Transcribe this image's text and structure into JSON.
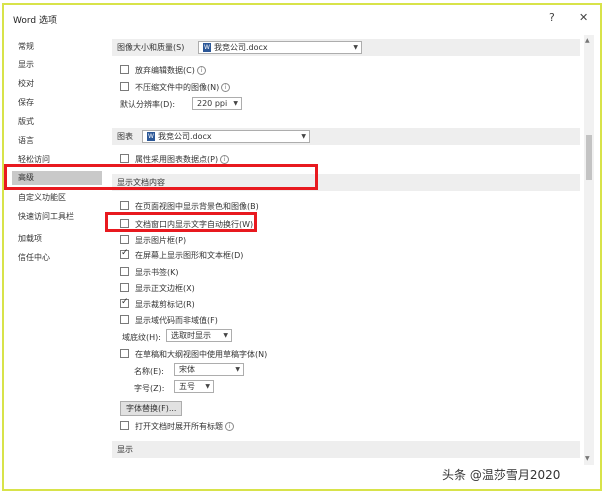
{
  "window": {
    "title": "Word 选项",
    "help": "?",
    "close": "✕"
  },
  "sidebar": {
    "items": [
      {
        "label": "常规"
      },
      {
        "label": "显示"
      },
      {
        "label": "校对"
      },
      {
        "label": "保存"
      },
      {
        "label": "版式"
      },
      {
        "label": "语言"
      },
      {
        "label": "轻松访问"
      },
      {
        "label": "高级"
      },
      {
        "label": "自定义功能区"
      },
      {
        "label": "快速访问工具栏"
      },
      {
        "label": "加载项"
      },
      {
        "label": "信任中心"
      }
    ],
    "selected": "高级"
  },
  "image_section": {
    "header": "图像大小和质量(S)",
    "file": "我竞公司.docx",
    "opt_discard": "放弃编辑数据(C)",
    "opt_nocompress": "不压缩文件中的图像(N)",
    "resolution_label": "默认分辨率(D):",
    "resolution_value": "220 ppi"
  },
  "chart_section": {
    "header": "图表",
    "file": "我竞公司.docx",
    "opt_props": "属性采用图表数据点(P)"
  },
  "doc_content": {
    "header": "显示文档内容",
    "items": [
      {
        "label": "在页面视图中显示背景色和图像(B)",
        "checked": false
      },
      {
        "label": "文档窗口内显示文字自动换行(W)",
        "checked": false
      },
      {
        "label": "显示图片框(P)",
        "checked": false
      },
      {
        "label": "在屏幕上显示图形和文本框(D)",
        "checked": true
      },
      {
        "label": "显示书签(K)",
        "checked": false
      },
      {
        "label": "显示正文边框(X)",
        "checked": false
      },
      {
        "label": "显示裁剪标记(R)",
        "checked": true
      },
      {
        "label": "显示域代码而非域值(F)",
        "checked": false
      }
    ],
    "shading_label": "域底纹(H):",
    "shading_value": "选取时显示",
    "draft_font_opt": "在草稿和大纲视图中使用草稿字体(N)",
    "name_label": "名称(E):",
    "name_value": "宋体",
    "size_label": "字号(Z):",
    "size_value": "五号",
    "font_sub_button": "字体替换(F)...",
    "expand_headings": "打开文档时展开所有标题"
  },
  "display_section": {
    "header": "显示"
  },
  "watermark": "头条 @温莎雪月2020"
}
